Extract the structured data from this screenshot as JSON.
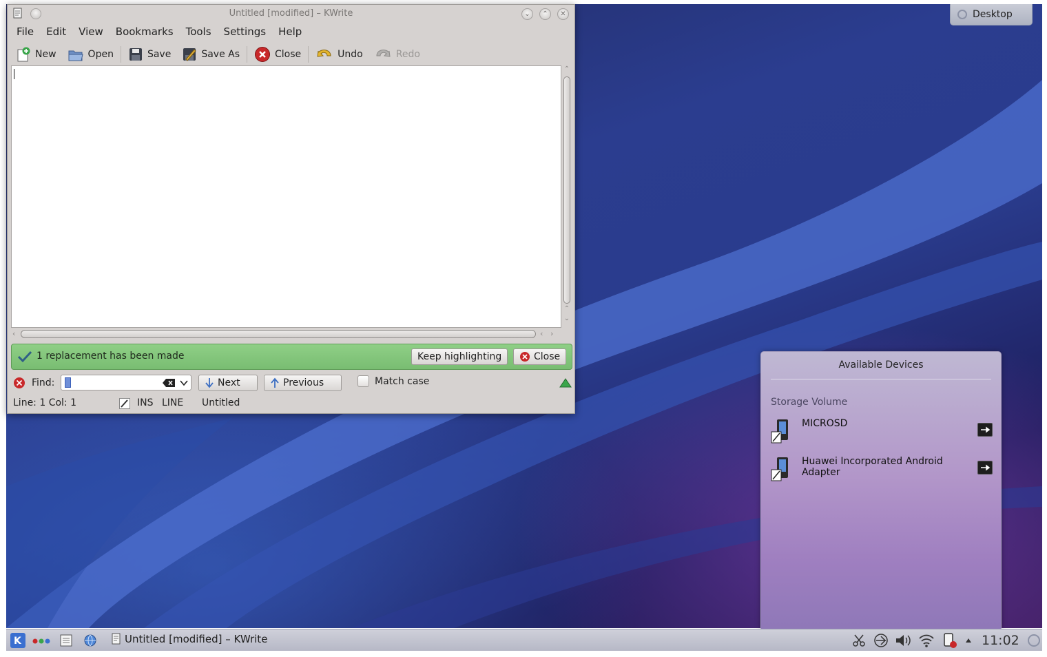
{
  "desktop": {
    "button_label": "Desktop"
  },
  "window": {
    "title": "Untitled [modified] – KWrite",
    "menu": [
      "File",
      "Edit",
      "View",
      "Bookmarks",
      "Tools",
      "Settings",
      "Help"
    ],
    "toolbar": {
      "new": "New",
      "open": "Open",
      "save": "Save",
      "save_as": "Save As",
      "close": "Close",
      "undo": "Undo",
      "redo": "Redo"
    },
    "editor_text": "",
    "notification": {
      "message": "1 replacement has been made",
      "keep_highlighting": "Keep highlighting",
      "close": "Close",
      "color": "#7fc478"
    },
    "findbar": {
      "label": "Find:",
      "value": "",
      "next": "Next",
      "previous": "Previous",
      "match_case": "Match case",
      "match_case_checked": false
    },
    "status": {
      "position": "Line: 1 Col: 1",
      "mode": "INS",
      "selection": "LINE",
      "filename": "Untitled"
    }
  },
  "devices_popup": {
    "title": "Available Devices",
    "section": "Storage Volume",
    "items": [
      {
        "name": "MICROSD"
      },
      {
        "name": "Huawei Incorporated Android Adapter"
      }
    ]
  },
  "panel": {
    "task_title": "Untitled [modified] – KWrite",
    "clock": "11:02"
  }
}
